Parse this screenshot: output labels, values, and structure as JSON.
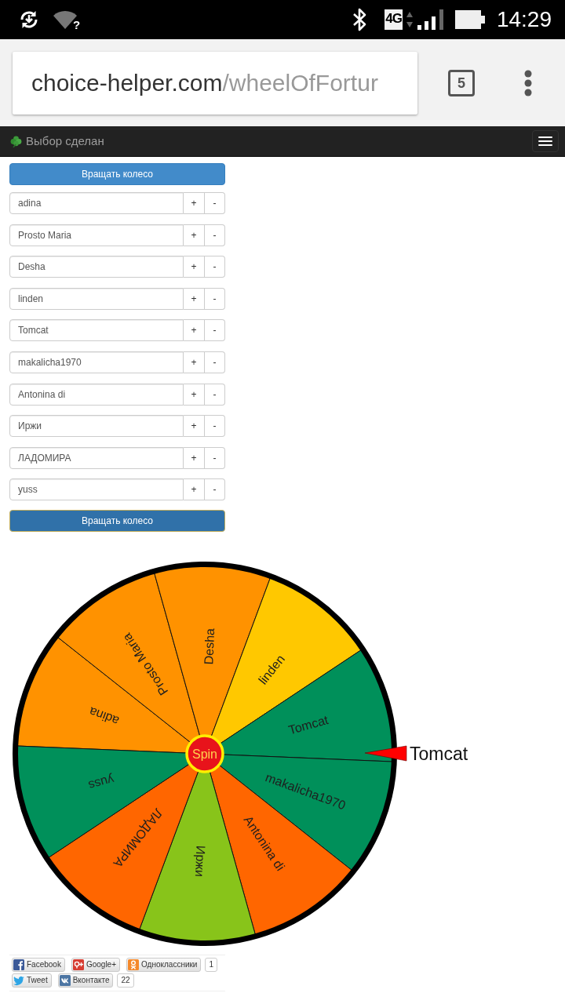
{
  "status_bar": {
    "wifi_mark": "?",
    "network": "4G",
    "time": "14:29"
  },
  "browser": {
    "address_host": "choice-helper.com",
    "address_path": "/wheelOfFortur",
    "tab_count": "5"
  },
  "navbar": {
    "brand": "Выбор сделан"
  },
  "spin_button_top": {
    "label": "Вращать колесо",
    "focused": false
  },
  "entries": [
    {
      "value": "adina",
      "plus": "+",
      "minus": "-"
    },
    {
      "value": "Prosto Maria",
      "plus": "+",
      "minus": "-"
    },
    {
      "value": "Desha",
      "plus": "+",
      "minus": "-"
    },
    {
      "value": "linden",
      "plus": "+",
      "minus": "-"
    },
    {
      "value": "Tomcat",
      "plus": "+",
      "minus": "-"
    },
    {
      "value": "makalicha1970",
      "plus": "+",
      "minus": "-"
    },
    {
      "value": "Antonina di",
      "plus": "+",
      "minus": "-"
    },
    {
      "value": "Иржи",
      "plus": "+",
      "minus": "-"
    },
    {
      "value": "ЛАДОМИРА",
      "plus": "+",
      "minus": "-"
    },
    {
      "value": "yuss",
      "plus": "+",
      "minus": "-"
    }
  ],
  "spin_button_bottom": {
    "label": "Вращать колесо",
    "focused": true
  },
  "wheel": {
    "segments": [
      {
        "label": "adina",
        "color": "#ff9200"
      },
      {
        "label": "Prosto Maria",
        "color": "#ff9200"
      },
      {
        "label": "Desha",
        "color": "#ff9200"
      },
      {
        "label": "linden",
        "color": "#ffc800"
      },
      {
        "label": "Tomcat",
        "color": "#00905a"
      },
      {
        "label": "makalicha1970",
        "color": "#00905a"
      },
      {
        "label": "Antonina di",
        "color": "#ff6600"
      },
      {
        "label": "Иржи",
        "color": "#88c41a"
      },
      {
        "label": "ЛАДОМИРА",
        "color": "#ff6600"
      },
      {
        "label": "yuss",
        "color": "#00905a"
      }
    ],
    "hub_label": "Spin",
    "result": "Tomcat"
  },
  "share": {
    "buttons": [
      {
        "kind": "facebook",
        "label": "Facebook"
      },
      {
        "kind": "googleplus",
        "label": "Google+"
      },
      {
        "kind": "odnoklassniki",
        "label": "Одноклассники",
        "count": "1"
      },
      {
        "kind": "twitter",
        "label": "Tweet"
      },
      {
        "kind": "vkontakte",
        "label": "Вконтакте",
        "count": "22"
      }
    ]
  }
}
